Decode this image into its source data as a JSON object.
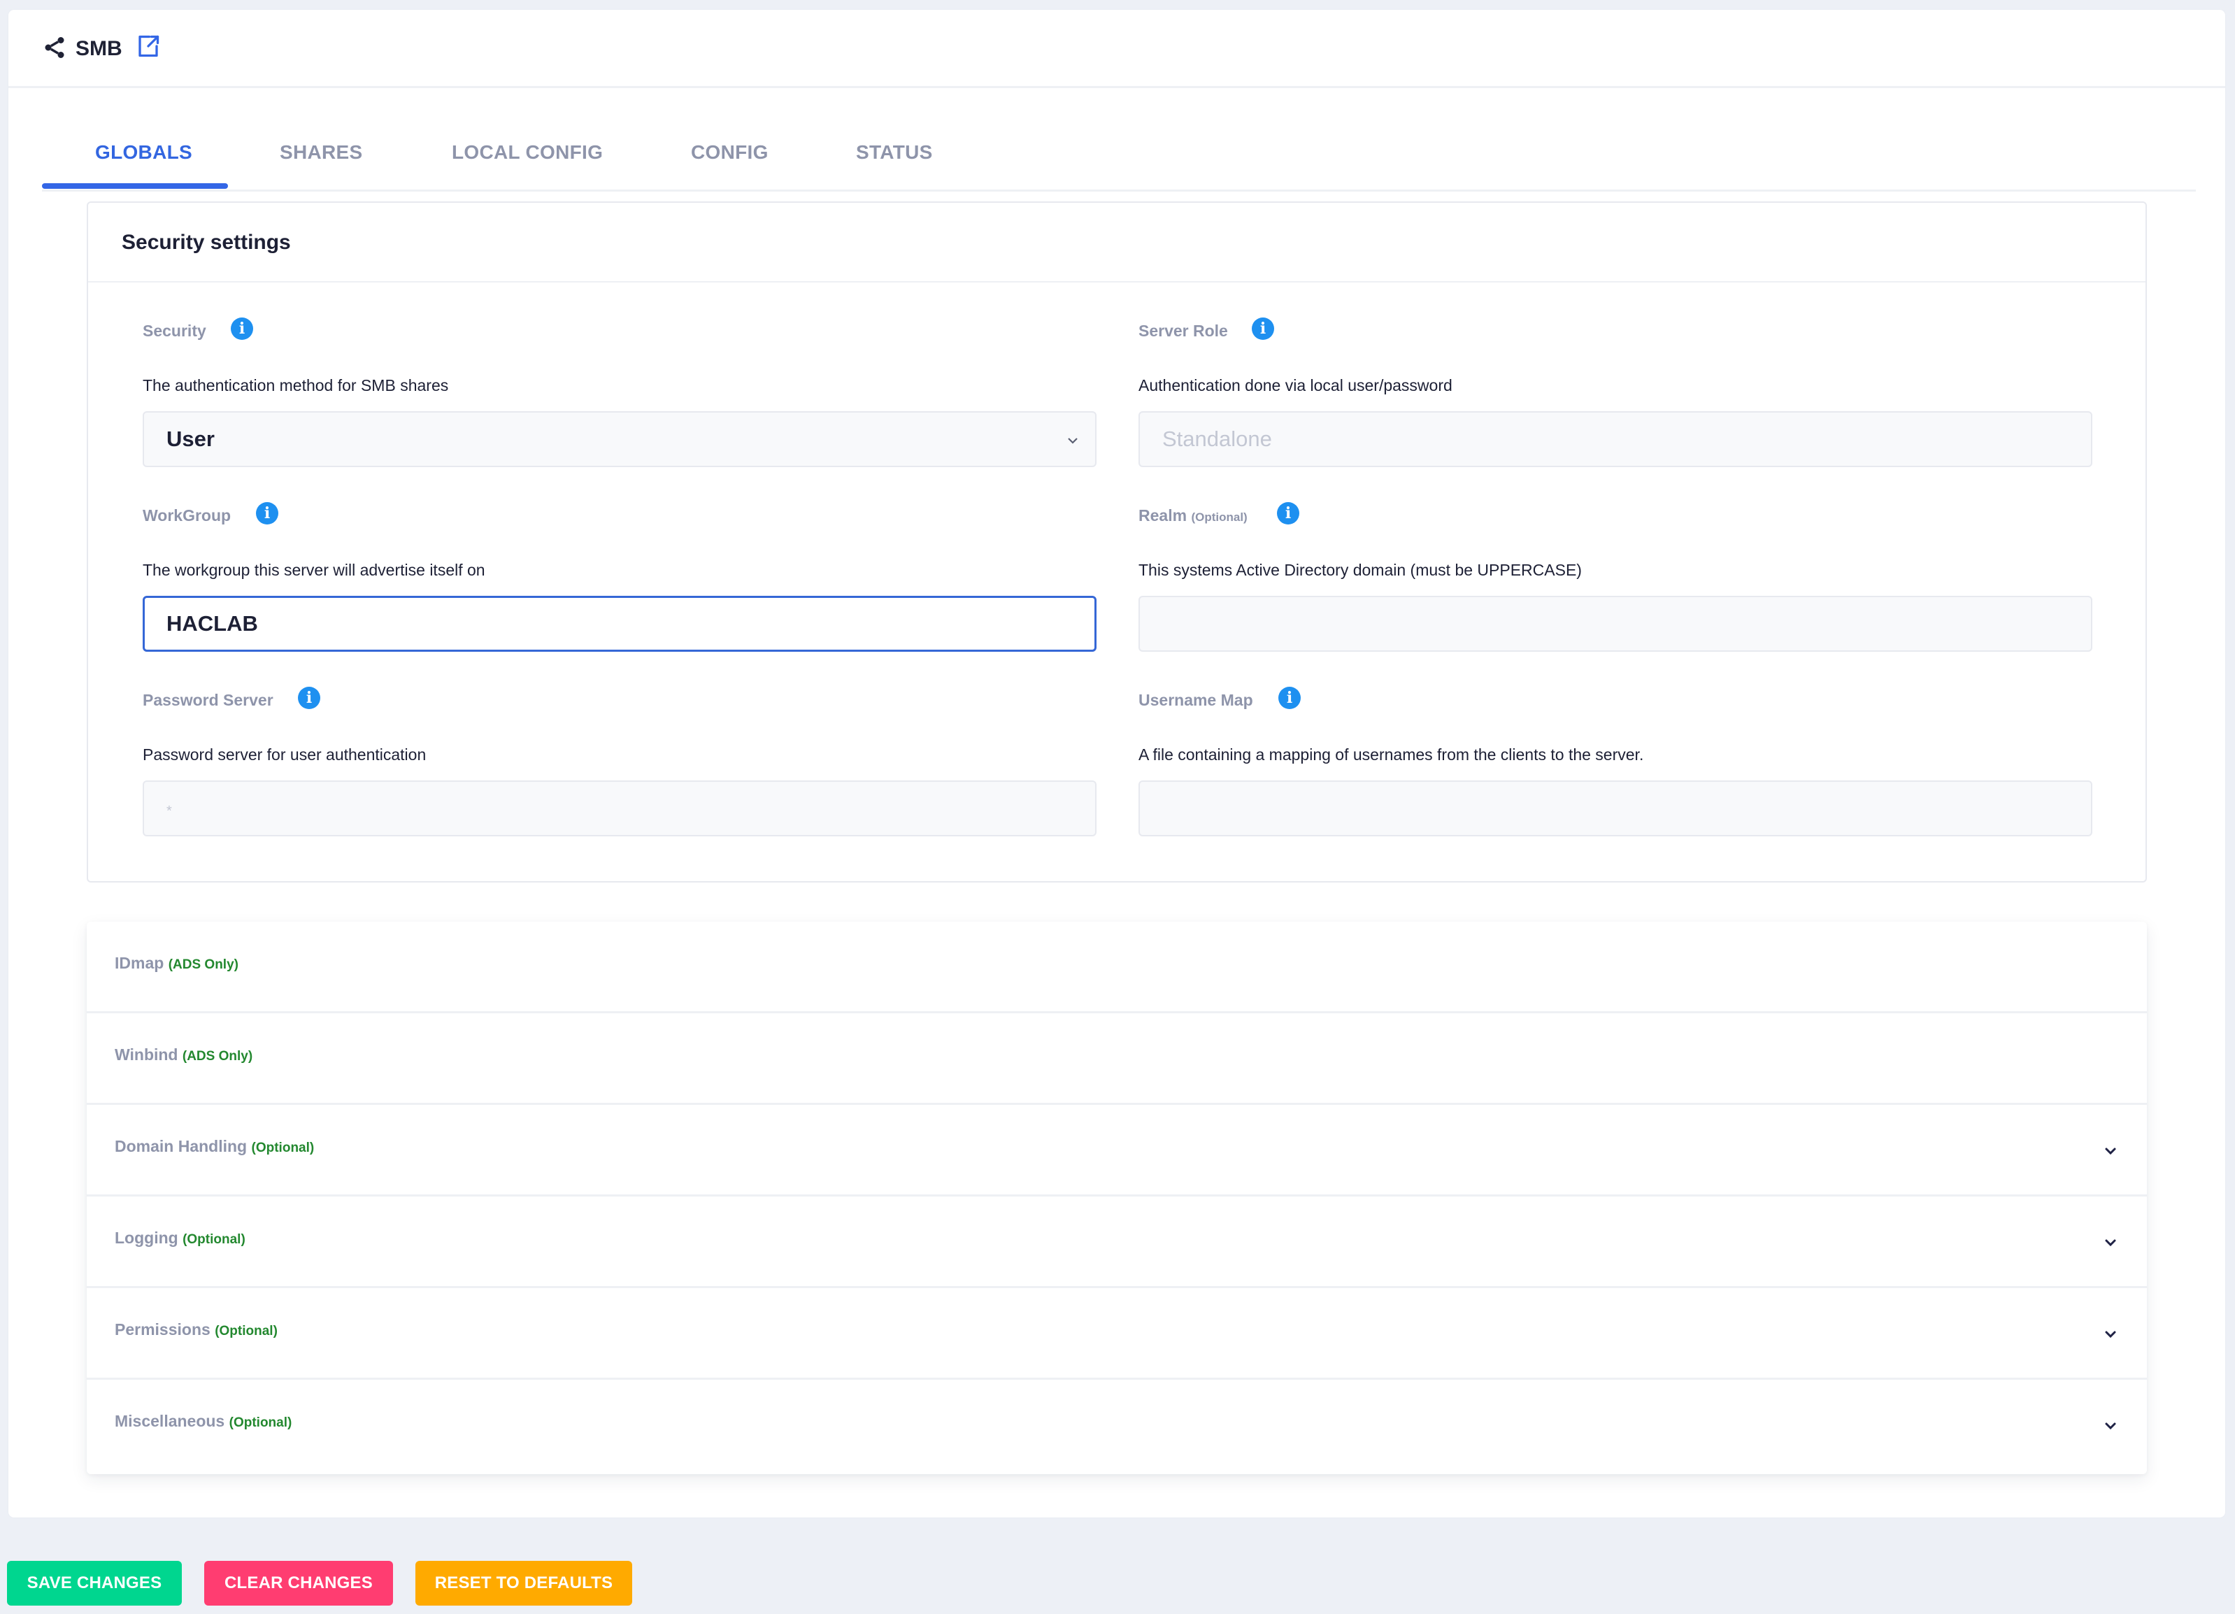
{
  "app": {
    "title": "SMB",
    "icon": "share-icon",
    "open_external_icon": "external-link-icon"
  },
  "tabs": [
    {
      "label": "GLOBALS",
      "active": true
    },
    {
      "label": "SHARES",
      "active": false
    },
    {
      "label": "LOCAL CONFIG",
      "active": false
    },
    {
      "label": "CONFIG",
      "active": false
    },
    {
      "label": "STATUS",
      "active": false
    }
  ],
  "security_settings": {
    "title": "Security settings",
    "fields": {
      "security": {
        "label": "Security",
        "description": "The authentication method for SMB shares",
        "value": "User",
        "type": "select"
      },
      "server_role": {
        "label": "Server Role",
        "description": "Authentication done via local user/password",
        "value": "Standalone",
        "type": "disabled-input"
      },
      "workgroup": {
        "label": "WorkGroup",
        "description": "The workgroup this server will advertise itself on",
        "value": "HACLAB",
        "type": "input"
      },
      "realm": {
        "label": "Realm",
        "optional_tag": "(Optional)",
        "description": "This systems Active Directory domain (must be UPPERCASE)",
        "value": "",
        "type": "input"
      },
      "password_server": {
        "label": "Password Server",
        "description": "Password server for user authentication",
        "value": "",
        "placeholder": "*",
        "type": "input"
      },
      "username_map": {
        "label": "Username Map",
        "description": "A file containing a mapping of usernames from the clients to the server.",
        "value": "",
        "type": "input"
      }
    }
  },
  "accordion": [
    {
      "title": "IDmap",
      "tag": "(ADS Only)",
      "expandable": false
    },
    {
      "title": "Winbind",
      "tag": "(ADS Only)",
      "expandable": false
    },
    {
      "title": "Domain Handling",
      "tag": "(Optional)",
      "expandable": true
    },
    {
      "title": "Logging",
      "tag": "(Optional)",
      "expandable": true
    },
    {
      "title": "Permissions",
      "tag": "(Optional)",
      "expandable": true
    },
    {
      "title": "Miscellaneous",
      "tag": "(Optional)",
      "expandable": true
    }
  ],
  "actions": {
    "save": {
      "label": "SAVE CHANGES",
      "color": "#00d68f"
    },
    "clear": {
      "label": "CLEAR CHANGES",
      "color": "#ff3d71"
    },
    "reset": {
      "label": "RESET TO DEFAULTS",
      "color": "#ffaa00"
    }
  },
  "colors": {
    "accent": "#3366e6",
    "info": "#1e90f0",
    "tag_green": "#23882f",
    "muted_label": "#8e94aa"
  }
}
